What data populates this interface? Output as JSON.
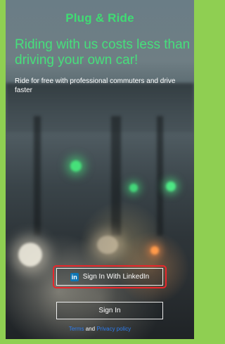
{
  "app": {
    "title": "Plug & Ride",
    "headline": "Riding with us costs less than driving your own car!",
    "subtext": "Ride for free with professional commuters and drive faster"
  },
  "actions": {
    "linkedin_label": "Sign In With LinkedIn",
    "signin_label": "Sign In"
  },
  "footer": {
    "terms_label": "Terms",
    "and_label": "and",
    "privacy_label": "Privacy policy"
  },
  "colors": {
    "accent_green": "#46e07b",
    "frame_green": "#8fcf52",
    "link_blue": "#2f7ef0",
    "highlight_red": "#e8262b",
    "linkedin_blue": "#0e76b5"
  },
  "icons": {
    "linkedin": "linkedin-icon"
  }
}
